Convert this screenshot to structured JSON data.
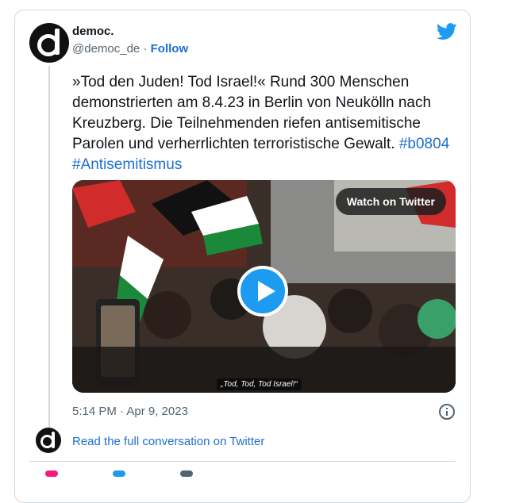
{
  "tweet": {
    "display_name": "democ.",
    "handle": "@democ_de",
    "separator": "·",
    "follow_label": "Follow",
    "text_main": "»Tod den Juden! Tod Israel!« Rund 300 Menschen demonstrierten am 8.4.23 in Berlin von Neukölln nach Kreuzberg. Die Teilnehmenden riefen antisemitische Parolen und verherrlichten terroristische Gewalt.",
    "hashtags": [
      "#b0804",
      "#Antisemitismus"
    ],
    "timestamp": "5:14 PM · Apr 9, 2023",
    "read_conversation_label": "Read the full conversation on Twitter"
  },
  "media": {
    "watch_label": "Watch on Twitter",
    "caption": "„Tod, Tod, Tod Israel!“"
  },
  "icons": {
    "brand": "twitter-bird-icon",
    "play": "play-icon",
    "info": "info-icon"
  },
  "colors": {
    "link": "#1d6fd1",
    "twitter_blue": "#1d9bf0",
    "secondary_text": "#536471"
  }
}
